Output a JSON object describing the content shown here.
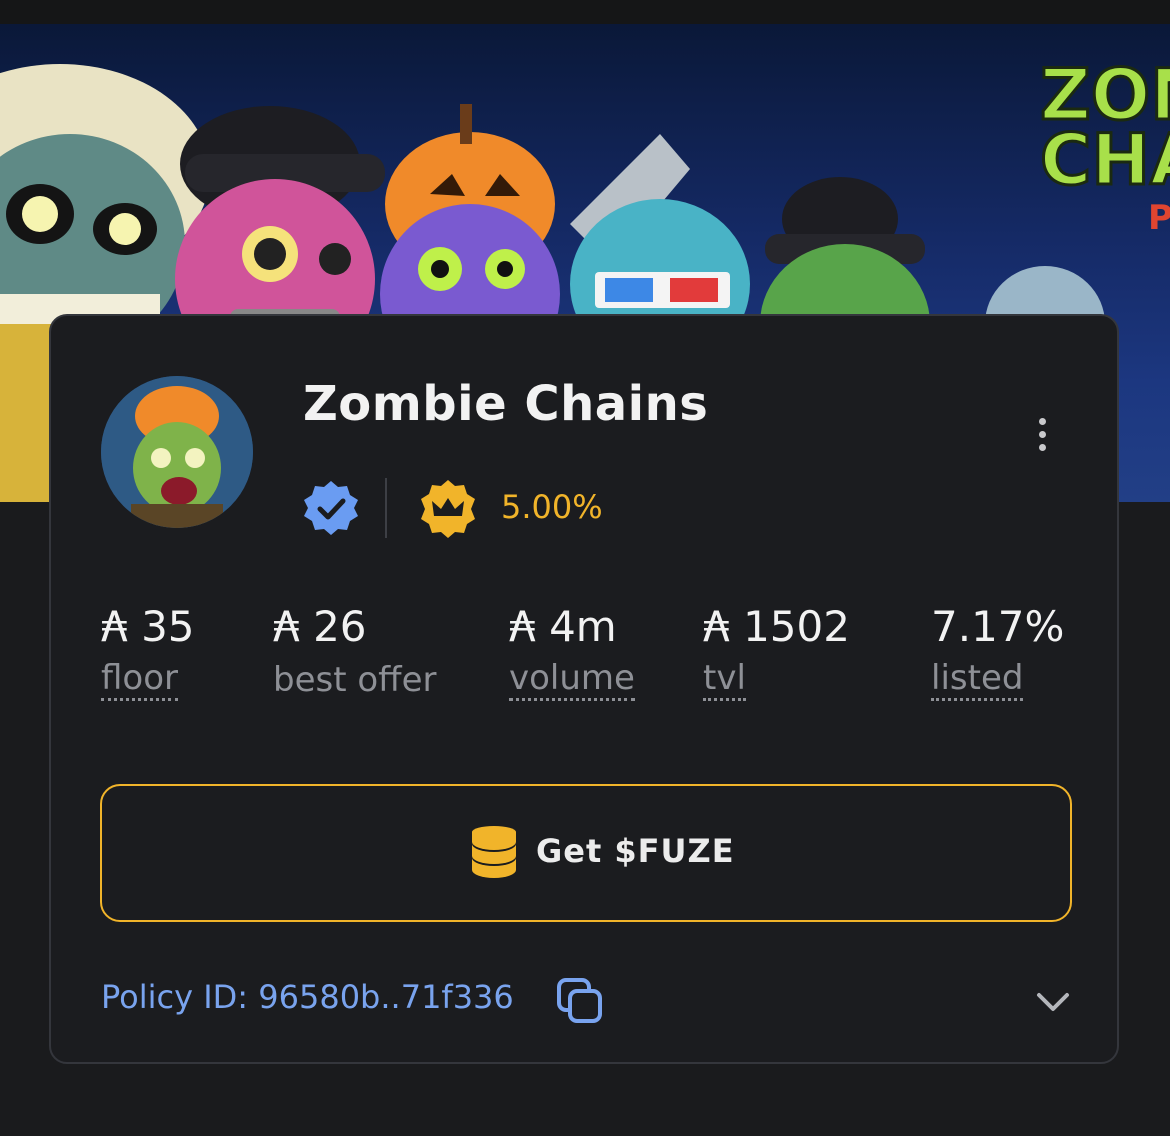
{
  "collection": {
    "name": "Zombie Chains",
    "royalty": "5.00%",
    "banner_text": [
      "ZOM",
      "CHA",
      "P"
    ]
  },
  "stats": [
    {
      "value": "₳ 35",
      "label": "floor"
    },
    {
      "value": "₳ 26",
      "label": "best offer"
    },
    {
      "value": "₳ 4m",
      "label": "volume"
    },
    {
      "value": "₳ 1502",
      "label": "tvl"
    },
    {
      "value": "7.17%",
      "label": "listed"
    }
  ],
  "actions": {
    "get_fuze_label": "Get $FUZE"
  },
  "policy": {
    "text": "Policy ID: 96580b..71f336"
  },
  "colors": {
    "accent_gold": "#f1b42a",
    "verified_blue": "#6a9cf2",
    "link_blue": "#79a3ee",
    "card_bg": "#1b1c1f"
  },
  "icons": [
    "verified-badge-icon",
    "crown-icon",
    "coin-stack-icon",
    "copy-icon",
    "chevron-down-icon",
    "more-vertical-icon"
  ]
}
